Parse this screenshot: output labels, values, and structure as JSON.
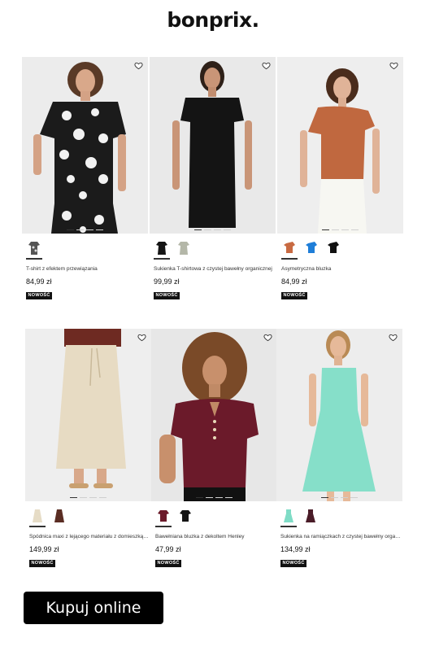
{
  "brand": {
    "logo": "bonprix."
  },
  "products": [
    {
      "name": "T-shirt z efektem przewiązania",
      "price": "84,99 zł",
      "badge": "NOWOŚĆ",
      "bg": "#ececec",
      "swatches": [
        {
          "color": "#2b2b2b",
          "pattern": "floral"
        }
      ]
    },
    {
      "name": "Sukienka T-shirtowa z czystej bawełny organicznej",
      "price": "99,99 zł",
      "badge": "NOWOŚĆ",
      "bg": "#e9e9e9",
      "swatches": [
        {
          "color": "#151515"
        },
        {
          "color": "#b4b7a8"
        }
      ]
    },
    {
      "name": "Asymetryczna bluzka",
      "price": "84,99 zł",
      "badge": "NOWOŚĆ",
      "bg": "#eeeeee",
      "swatches": [
        {
          "color": "#c86a42"
        },
        {
          "color": "#1f7ed8"
        },
        {
          "color": "#111111"
        }
      ]
    },
    {
      "name": "Spódnica maxi z lejącego materiału z domieszką ly...",
      "price": "149,99 zł",
      "badge": "NOWOŚĆ",
      "bg": "#eeeeee",
      "swatches": [
        {
          "color": "#e6dcc6"
        },
        {
          "color": "#5a2d23"
        }
      ]
    },
    {
      "name": "Bawełniana bluzka z dekoltem Henley",
      "price": "47,99 zł",
      "badge": "NOWOŚĆ",
      "bg": "#e7e7e7",
      "swatches": [
        {
          "color": "#6b1a2a"
        },
        {
          "color": "#141414"
        }
      ]
    },
    {
      "name": "Sukienka na ramiączkach z czystej bawełny organi...",
      "price": "134,99 zł",
      "badge": "NOWOŚĆ",
      "bg": "#ededed",
      "swatches": [
        {
          "color": "#7fdcc6"
        },
        {
          "color": "#4a1c28"
        }
      ]
    }
  ],
  "cta": {
    "label": "Kupuj online"
  },
  "icons": {
    "wishlist": "heart-icon"
  }
}
